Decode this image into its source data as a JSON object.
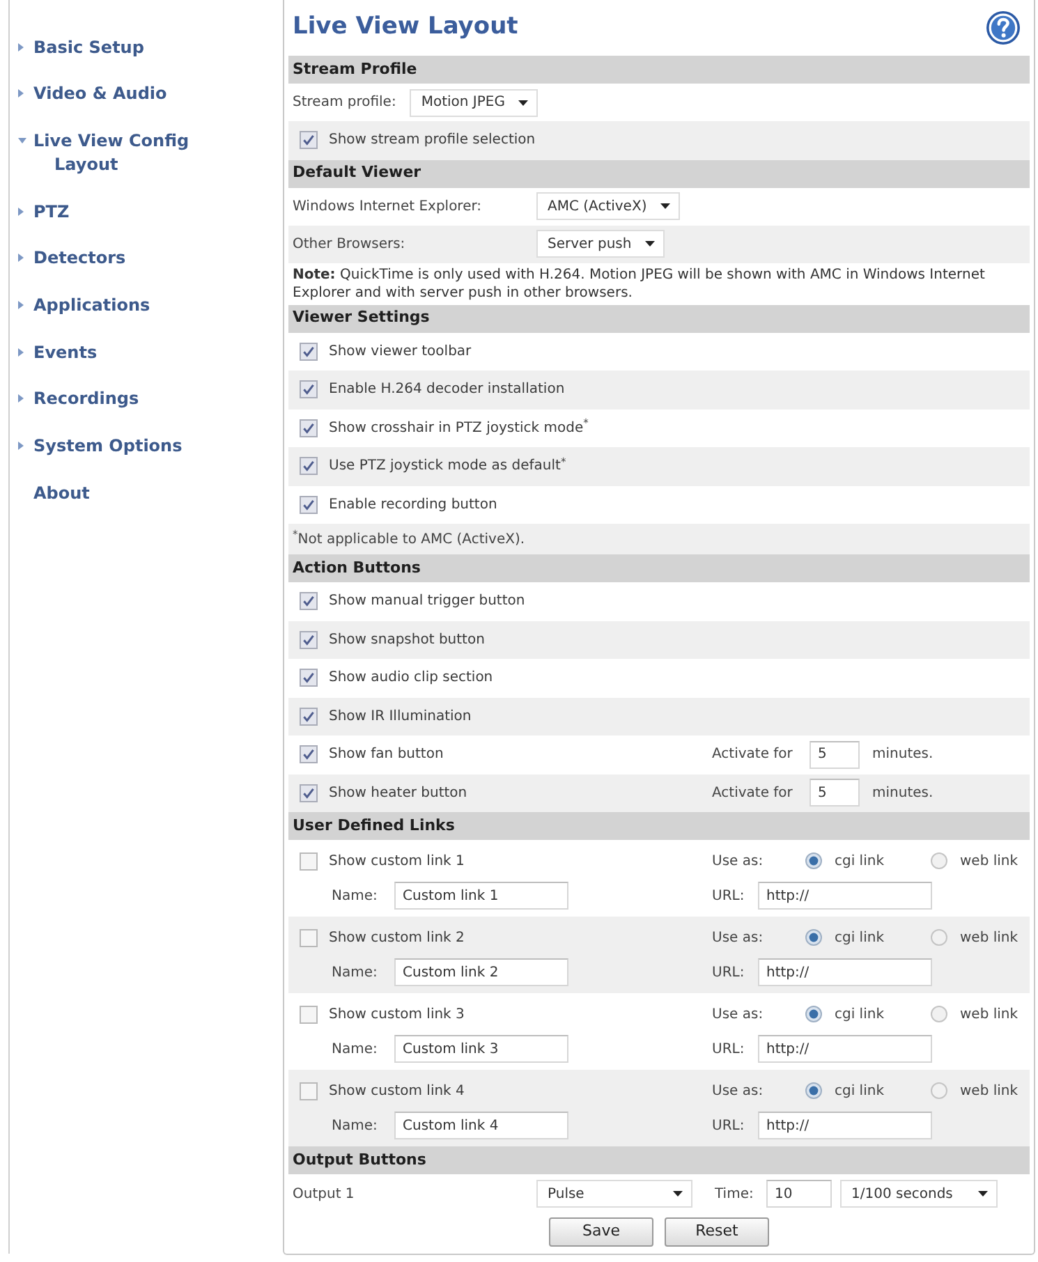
{
  "sidebar": {
    "items": [
      {
        "kind": "group",
        "label": "Basic Setup",
        "expanded": false
      },
      {
        "kind": "group",
        "label": "Video & Audio",
        "expanded": false
      },
      {
        "kind": "group",
        "label": "Live View Config",
        "expanded": true,
        "children": [
          {
            "label": "Layout"
          }
        ]
      },
      {
        "kind": "group",
        "label": "PTZ",
        "expanded": false
      },
      {
        "kind": "group",
        "label": "Detectors",
        "expanded": false
      },
      {
        "kind": "group",
        "label": "Applications",
        "expanded": false
      },
      {
        "kind": "group",
        "label": "Events",
        "expanded": false
      },
      {
        "kind": "group",
        "label": "Recordings",
        "expanded": false
      },
      {
        "kind": "group",
        "label": "System Options",
        "expanded": false
      },
      {
        "kind": "link",
        "label": "About"
      }
    ]
  },
  "page": {
    "title": "Live View Layout"
  },
  "sections": [
    {
      "title": "Stream Profile",
      "rows": [
        {
          "kind": "select",
          "label": "Stream profile:",
          "value": "Motion JPEG"
        },
        {
          "kind": "checkbox",
          "label": "Show stream profile selection",
          "checked": true
        }
      ]
    },
    {
      "title": "Default Viewer",
      "rows": [
        {
          "kind": "select",
          "label": "Windows Internet Explorer:",
          "value": "AMC (ActiveX)"
        },
        {
          "kind": "select",
          "label": "Other Browsers:",
          "value": "Server push"
        },
        {
          "kind": "note",
          "text": "**Note:** QuickTime is only used with H.264. Motion JPEG will be shown with AMC in Windows Internet Explorer and with server push in other browsers."
        }
      ]
    },
    {
      "title": "Viewer Settings",
      "rows": [
        {
          "kind": "checkbox",
          "label": "Show viewer toolbar",
          "checked": true
        },
        {
          "kind": "checkbox",
          "label": "Enable H.264 decoder installation",
          "checked": true
        },
        {
          "kind": "checkbox",
          "label": "Show crosshair in PTZ joystick mode$^{*}$",
          "checked": true
        },
        {
          "kind": "checkbox",
          "label": "Use PTZ joystick mode as default$^{*}$",
          "checked": true
        },
        {
          "kind": "checkbox",
          "label": "Enable recording button",
          "checked": true
        },
        {
          "kind": "footnote",
          "text": "$^{*}$Not applicable to AMC (ActiveX)."
        }
      ]
    },
    {
      "title": "Action Buttons",
      "rows": [
        {
          "kind": "checkbox",
          "label": "Show manual trigger button",
          "checked": true
        },
        {
          "kind": "checkbox",
          "label": "Show snapshot button",
          "checked": true
        },
        {
          "kind": "checkbox",
          "label": "Show audio clip section",
          "checked": true
        },
        {
          "kind": "checkbox",
          "label": "Show IR Illumination",
          "checked": true
        },
        {
          "kind": "checkbox",
          "label": "Show fan button",
          "checked": true,
          "activate": {
            "label": "Activate for",
            "value": "5",
            "unit": "minutes."
          }
        },
        {
          "kind": "checkbox",
          "label": "Show heater button",
          "checked": true,
          "activate": {
            "label": "Activate for",
            "value": "5",
            "unit": "minutes."
          }
        }
      ]
    },
    {
      "title": "User Defined Links",
      "rows": [
        {
          "kind": "custom_link",
          "label": "Show custom link 1",
          "checked": false,
          "use_as_label": "Use as:",
          "options": [
            {
              "label": "cgi link",
              "selected": true
            },
            {
              "label": "web link",
              "selected": false
            }
          ],
          "name_label": "Name:",
          "name_value": "Custom link 1",
          "url_label": "URL:",
          "url_value": "http://"
        },
        {
          "kind": "custom_link",
          "label": "Show custom link 2",
          "checked": false,
          "use_as_label": "Use as:",
          "options": [
            {
              "label": "cgi link",
              "selected": true
            },
            {
              "label": "web link",
              "selected": false
            }
          ],
          "name_label": "Name:",
          "name_value": "Custom link 2",
          "url_label": "URL:",
          "url_value": "http://"
        },
        {
          "kind": "custom_link",
          "label": "Show custom link 3",
          "checked": false,
          "use_as_label": "Use as:",
          "options": [
            {
              "label": "cgi link",
              "selected": true
            },
            {
              "label": "web link",
              "selected": false
            }
          ],
          "name_label": "Name:",
          "name_value": "Custom link 3",
          "url_label": "URL:",
          "url_value": "http://"
        },
        {
          "kind": "custom_link",
          "label": "Show custom link 4",
          "checked": false,
          "use_as_label": "Use as:",
          "options": [
            {
              "label": "cgi link",
              "selected": true
            },
            {
              "label": "web link",
              "selected": false
            }
          ],
          "name_label": "Name:",
          "name_value": "Custom link 4",
          "url_label": "URL:",
          "url_value": "http://"
        }
      ]
    },
    {
      "title": "Output Buttons",
      "rows": [
        {
          "kind": "output",
          "label": "Output 1",
          "mode": "Pulse",
          "time_label": "Time:",
          "time_value": "10",
          "unit": "1/100 seconds"
        }
      ]
    }
  ],
  "buttons": [
    {
      "label": "Save"
    },
    {
      "label": "Reset"
    }
  ]
}
